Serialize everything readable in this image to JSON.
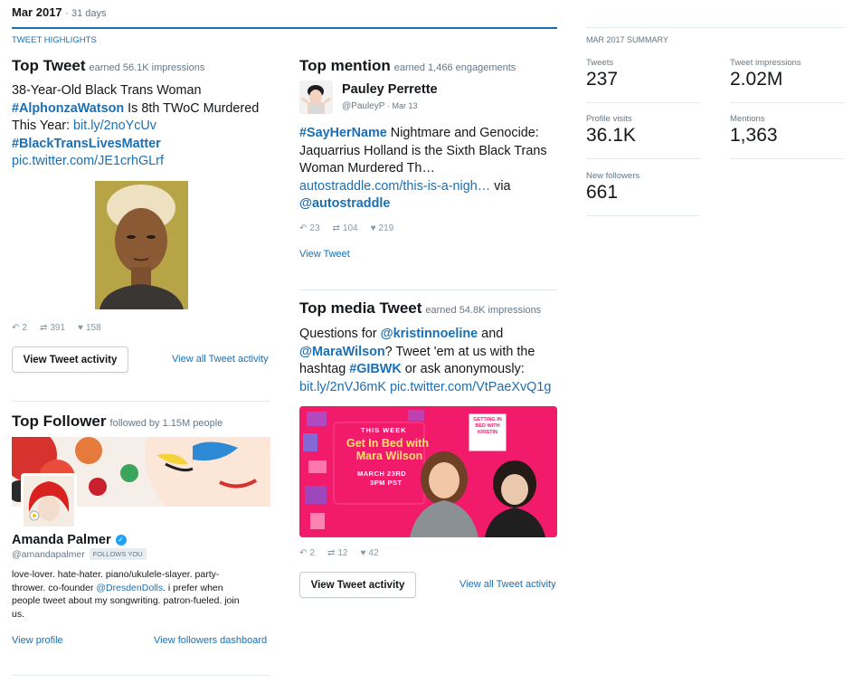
{
  "header": {
    "month": "Mar 2017",
    "days": "· 31 days"
  },
  "highlights_label": "TWEET HIGHLIGHTS",
  "top_tweet": {
    "title": "Top Tweet",
    "sub": "earned 56.1K impressions",
    "text_1": "38-Year-Old Black Trans Woman",
    "tag_1": "#AlphonzaWatson",
    "text_2": " Is 8th TWoC Murdered",
    "text_3": "This Year: ",
    "url_1": "bit.ly/2noYcUv",
    "tag_2": "#BlackTransLivesMatter",
    "url_2": "pic.twitter.com/JE1crhGLrf",
    "replies": "2",
    "retweets": "391",
    "likes": "158",
    "button": "View Tweet activity",
    "link": "View all Tweet activity"
  },
  "top_mention": {
    "title": "Top mention",
    "sub": "earned 1,466 engagements",
    "name": "Pauley Perrette",
    "handle": "@PauleyP",
    "date": "· Mar 13",
    "tag_1": "#SayHerName",
    "text_1": " Nightmare and Genocide:",
    "text_2": "Jaquarrius Holland is the Sixth Black Trans",
    "text_3": "Woman Murdered Th…",
    "url_1": "autostraddle.com/this-is-a-nigh…",
    "text_4": " via",
    "mention_1": "@autostraddle",
    "replies": "23",
    "retweets": "104",
    "likes": "219",
    "link": "View Tweet"
  },
  "top_media": {
    "title": "Top media Tweet",
    "sub": "earned 54.8K impressions",
    "text_1": "Questions for ",
    "mention_1": "@kristinnoeline",
    "text_2": " and",
    "mention_2": "@MaraWilson",
    "text_3": "? Tweet 'em at us with the",
    "text_4": "hashtag ",
    "tag_1": "#GIBWK",
    "text_5": " or ask anonymously:",
    "url_1": "bit.ly/2nVJ6mK",
    "url_2": " pic.twitter.com/VtPaeXvQ1g",
    "banner": {
      "this_week": "THIS WEEK",
      "title_1": "Get In Bed with",
      "title_2": "Mara Wilson",
      "date_1": "MARCH 23RD",
      "date_2": "3PM PST",
      "sign": "GETTING IN BED WITH KRISTIN"
    },
    "replies": "2",
    "retweets": "12",
    "likes": "42",
    "button": "View Tweet activity",
    "link": "View all Tweet activity"
  },
  "top_follower": {
    "title": "Top Follower",
    "sub": "followed by 1.15M people",
    "name": "Amanda Palmer",
    "handle": "@amandapalmer",
    "follows_badge": "FOLLOWS YOU",
    "bio_1": "love-lover. hate-hater. piano/ukulele-slayer. party-",
    "bio_2": "thrower. co-founder ",
    "bio_mention": "@DresdenDolls",
    "bio_3": ". i prefer when",
    "bio_4": "people tweet about my songwriting. patron-fueled. join",
    "bio_5": "us.",
    "link_profile": "View profile",
    "link_dashboard": "View followers dashboard"
  },
  "summary": {
    "label": "MAR 2017 SUMMARY",
    "items": [
      {
        "label": "Tweets",
        "value": "237"
      },
      {
        "label": "Tweet impressions",
        "value": "2.02M"
      },
      {
        "label": "Profile visits",
        "value": "36.1K"
      },
      {
        "label": "Mentions",
        "value": "1,363"
      },
      {
        "label": "New followers",
        "value": "661"
      }
    ]
  },
  "colors": {
    "accent": "#1b6fb4",
    "banner_pink": "#f21b6b",
    "verified": "#1da1f2"
  }
}
